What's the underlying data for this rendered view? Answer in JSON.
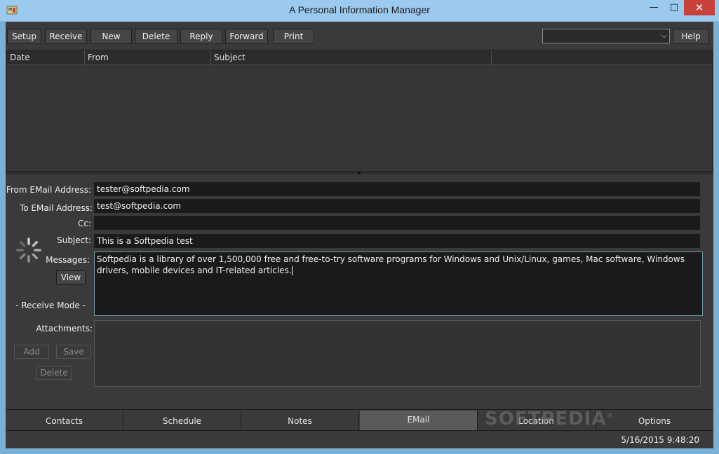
{
  "window": {
    "title": "A Personal Information Manager",
    "minimize": "—",
    "maximize": "□",
    "close": "✕"
  },
  "toolbar": {
    "setup": "Setup",
    "receive": "Receive",
    "new": "New",
    "delete": "Delete",
    "reply": "Reply",
    "forward": "Forward",
    "print": "Print",
    "help": "Help",
    "account_select_value": ""
  },
  "grid": {
    "columns": [
      "Date",
      "From",
      "Subject"
    ]
  },
  "form": {
    "from_label": "From EMail Address:",
    "from_value": "tester@softpedia.com",
    "to_label": "To EMail Address:",
    "to_value": "test@softpedia.com",
    "cc_label": "Cc:",
    "cc_value": "",
    "subject_label": "Subject:",
    "subject_value": "This is a Softpedia test",
    "messages_label": "Messages:",
    "messages_value": "Softpedia is a library of over 1,500,000 free and free-to-try software programs for Windows and Unix/Linux, games, Mac software, Windows drivers, mobile devices and IT-related articles.",
    "view_button": "View",
    "receive_mode": "- Receive Mode -",
    "attachments_label": "Attachments:",
    "add_button": "Add",
    "save_button": "Save",
    "delete_button": "Delete"
  },
  "tabs": [
    "Contacts",
    "Schedule",
    "Notes",
    "EMail",
    "Location",
    "Options"
  ],
  "active_tab": "EMail",
  "status": {
    "datetime": "5/16/2015 9:48:20"
  },
  "watermark": "SOFTPEDIA",
  "colors": {
    "background": "#3a3a3a",
    "field": "#1a1a1a",
    "titlebar": "#9cc9ee",
    "close": "#c8413a"
  }
}
